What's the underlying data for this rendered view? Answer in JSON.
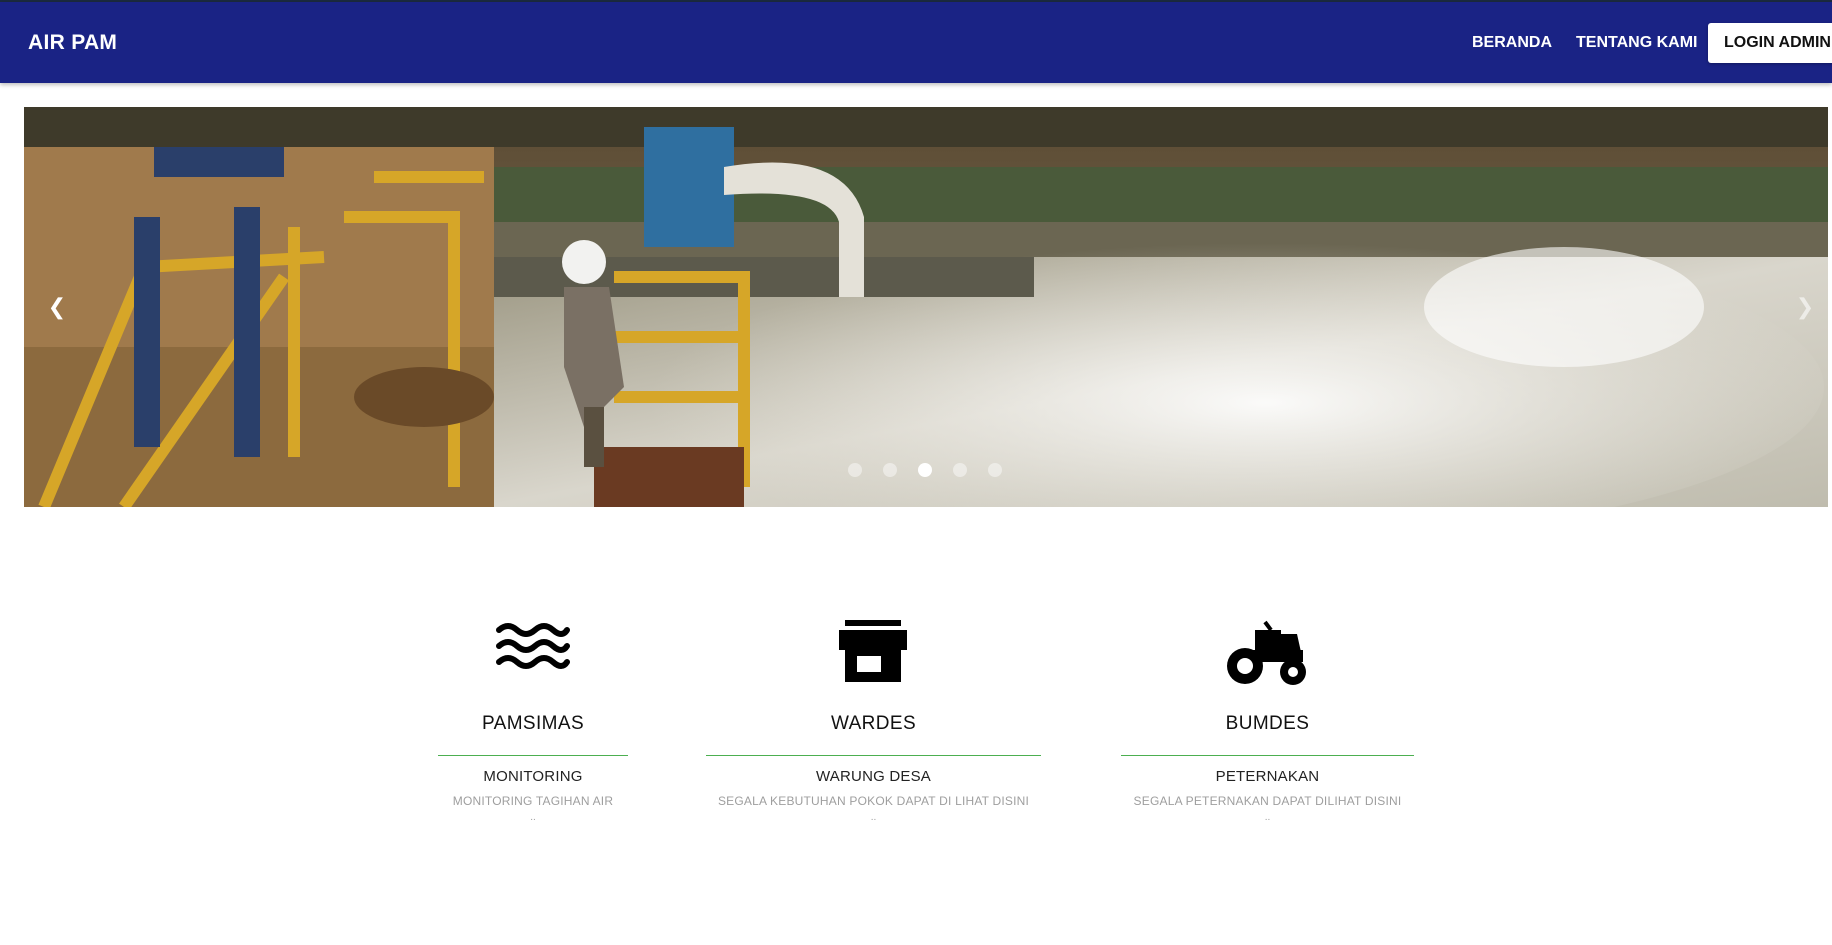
{
  "navbar": {
    "brand": "AIR PAM",
    "links": [
      "BERANDA",
      "TENTANG KAMI"
    ],
    "login": "LOGIN ADMIN",
    "color": "#1a2385"
  },
  "carousel": {
    "prev_icon": "chevron-left-icon",
    "next_icon": "chevron-right-icon",
    "slide_count": 5,
    "active_index": 2
  },
  "features": [
    {
      "icon": "water-waves-icon",
      "title": "PAMSIMAS",
      "subtitle": "MONITORING",
      "description": "MONITORING TAGIHAN AIR",
      "more": ".."
    },
    {
      "icon": "store-icon",
      "title": "WARDES",
      "subtitle": "WARUNG DESA",
      "description": "SEGALA KEBUTUHAN POKOK DAPAT DI LIHAT DISINI",
      "more": ".."
    },
    {
      "icon": "tractor-icon",
      "title": "BUMDES",
      "subtitle": "PETERNAKAN",
      "description": "SEGALA PETERNAKAN DAPAT DILIHAT DISINI",
      "more": ".."
    }
  ],
  "colors": {
    "accent_rule": "#4caf50"
  }
}
